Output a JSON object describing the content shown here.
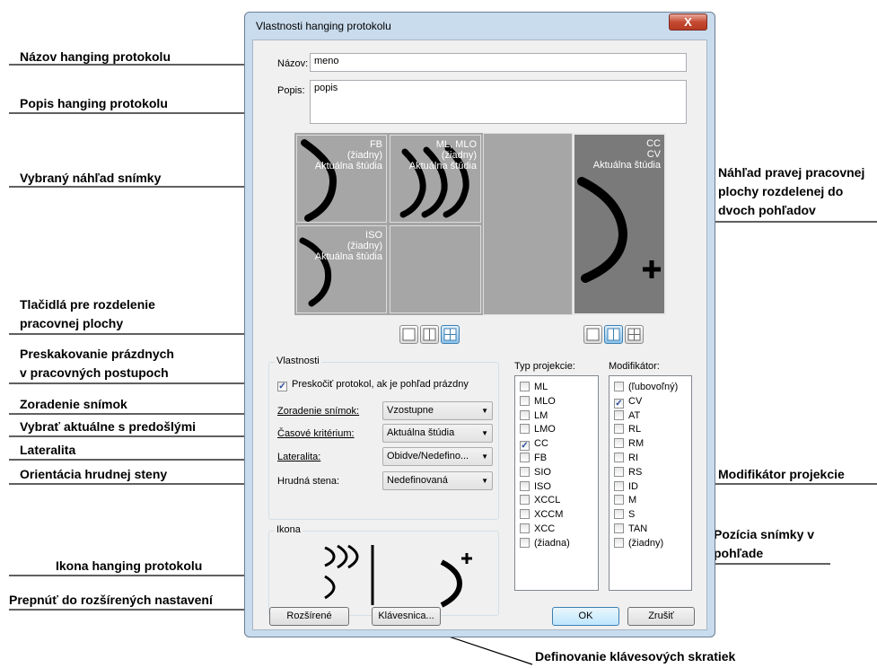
{
  "annotations": {
    "nazov": "Názov hanging protokolu",
    "popis": "Popis hanging protokolu",
    "vybrany": "Vybraný náhľad snímky",
    "nahlad_pravej": [
      "Náhľad pravej pracovnej",
      "plochy rozdelenej do",
      "dvoch pohľadov"
    ],
    "tlacidla": [
      "Tlačidlá pre rozdelenie",
      "pracovnej plochy"
    ],
    "preskakovanie": [
      "Preskakovanie prázdnych",
      "v pracovných postupoch"
    ],
    "zoradenie": "Zoradenie snímok",
    "vybrat": "Vybrať aktuálne s predošlými",
    "lateralita": "Lateralita",
    "orientacia": "Orientácia hrudnej steny",
    "modifikator": "Modifikátor projekcie",
    "pozicia": [
      "Pozícia snímky v",
      "pohľade"
    ],
    "ikona": "Ikona hanging protokolu",
    "prepnut": "Prepnúť do rozšírených nastavení",
    "definovanie": "Definovanie klávesových skratiek"
  },
  "dialog": {
    "title": "Vlastnosti hanging protokolu",
    "close": "X",
    "name_label": "Názov:",
    "name_value": "meno",
    "desc_label": "Popis:",
    "desc_value": "popis",
    "cells": {
      "c1": "FB\n(žiadny)\nAktuálna štúdia",
      "c2": "ML, MLO\n(žiadny)\nAktuálna štúdia",
      "c3": "ISO\n(žiadny)\nAktuálna štúdia",
      "c4": "CC\nCV\nAktuálna štúdia"
    },
    "props": {
      "group": "Vlastnosti",
      "skip": "Preskočiť protokol, ak je pohľad prázdny",
      "sort_label": "Zoradenie snímok:",
      "sort_value": "Vzostupne",
      "time_label": "Časové kritérium:",
      "time_value": "Aktuálna štúdia",
      "lat_label": "Lateralita:",
      "lat_value": "Obidve/Nedefino...",
      "wall_label": "Hrudná stena:",
      "wall_value": "Nedefinovaná"
    },
    "icon_group": "Ikona",
    "proj_label": "Typ projekcie:",
    "projections": [
      {
        "label": "ML",
        "checked": false
      },
      {
        "label": "MLO",
        "checked": false
      },
      {
        "label": "LM",
        "checked": false
      },
      {
        "label": "LMO",
        "checked": false
      },
      {
        "label": "CC",
        "checked": true
      },
      {
        "label": "FB",
        "checked": false
      },
      {
        "label": "SIO",
        "checked": false
      },
      {
        "label": "ISO",
        "checked": false
      },
      {
        "label": "XCCL",
        "checked": false
      },
      {
        "label": "XCCM",
        "checked": false
      },
      {
        "label": "XCC",
        "checked": false
      },
      {
        "label": "(žiadna)",
        "checked": false
      }
    ],
    "mod_label": "Modifikátor:",
    "modifiers": [
      {
        "label": "(ľubovoľný)",
        "checked": false
      },
      {
        "label": "CV",
        "checked": true
      },
      {
        "label": "AT",
        "checked": false
      },
      {
        "label": "RL",
        "checked": false
      },
      {
        "label": "RM",
        "checked": false
      },
      {
        "label": "RI",
        "checked": false
      },
      {
        "label": "RS",
        "checked": false
      },
      {
        "label": "ID",
        "checked": false
      },
      {
        "label": "M",
        "checked": false
      },
      {
        "label": "S",
        "checked": false
      },
      {
        "label": "TAN",
        "checked": false
      },
      {
        "label": "(žiadny)",
        "checked": false
      }
    ],
    "buttons": {
      "advanced": "Rozšírené",
      "keyboard": "Klávesnica...",
      "ok": "OK",
      "cancel": "Zrušiť"
    }
  }
}
